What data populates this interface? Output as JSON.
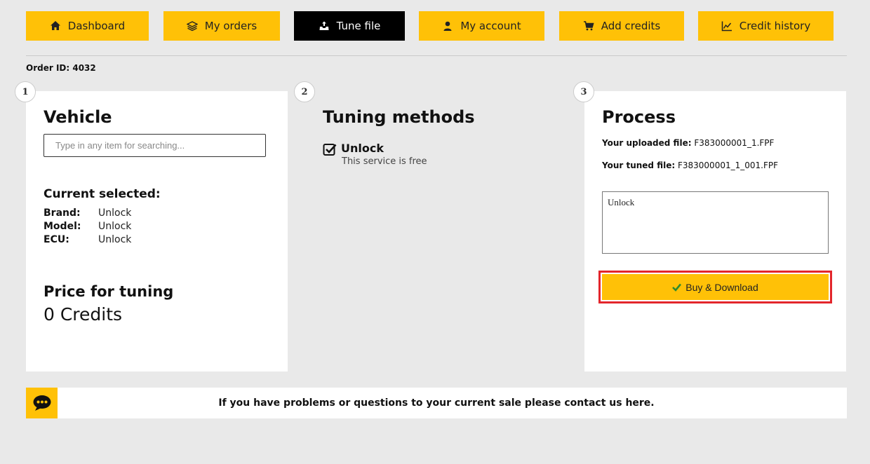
{
  "nav": {
    "items": [
      {
        "label": "Dashboard",
        "icon": "home-icon"
      },
      {
        "label": "My orders",
        "icon": "layers-icon"
      },
      {
        "label": "Tune file",
        "icon": "tune-icon",
        "active": true
      },
      {
        "label": "My account",
        "icon": "user-icon"
      },
      {
        "label": "Add credits",
        "icon": "cart-icon"
      },
      {
        "label": "Credit history",
        "icon": "chart-icon"
      }
    ]
  },
  "order": {
    "label": "Order ID: 4032"
  },
  "steps": [
    "1",
    "2",
    "3"
  ],
  "vehicle": {
    "title": "Vehicle",
    "search_placeholder": "Type in any item for searching...",
    "current_title": "Current selected:",
    "fields": [
      {
        "key": "Brand:",
        "value": "Unlock"
      },
      {
        "key": "Model:",
        "value": "Unlock"
      },
      {
        "key": "ECU:",
        "value": "Unlock"
      }
    ],
    "price_title": "Price for tuning",
    "price_value": "0 Credits"
  },
  "methods": {
    "title": "Tuning methods",
    "items": [
      {
        "name": "Unlock",
        "description": "This service is free",
        "checked": true
      }
    ]
  },
  "process": {
    "title": "Process",
    "uploaded_label": "Your uploaded file:",
    "uploaded_value": "F383000001_1.FPF",
    "tuned_label": "Your tuned file:",
    "tuned_value": "F383000001_1_001.FPF",
    "notes_value": "Unlock",
    "buy_label": "Buy & Download"
  },
  "contact": {
    "text": "If you have problems or questions to your current sale please contact us here."
  },
  "colors": {
    "accent": "#ffc107",
    "active_nav": "#000000",
    "highlight_border": "#e3262c",
    "background": "#e9e9e9"
  }
}
